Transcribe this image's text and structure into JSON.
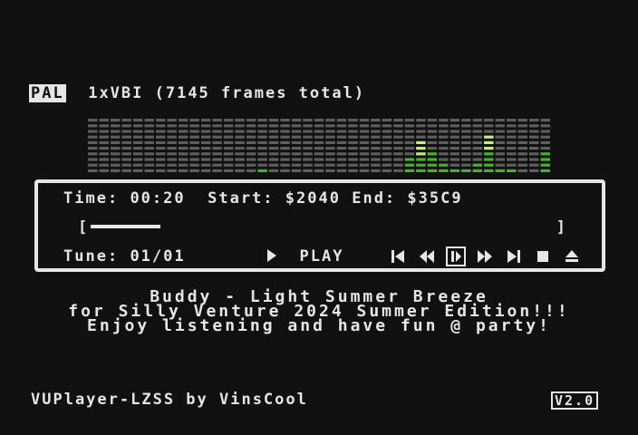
{
  "header": {
    "video_mode": "PAL",
    "info": "1xVBI (7145 frames total)"
  },
  "vu_meter": {
    "levels": [
      0,
      0,
      0,
      0,
      0,
      0,
      0,
      0,
      0,
      0,
      0,
      0,
      0,
      0,
      0,
      1,
      0,
      0,
      0,
      0,
      0,
      0,
      0,
      0,
      0,
      0,
      0,
      0,
      3,
      6,
      4,
      2,
      1,
      1,
      2,
      7,
      1,
      1,
      0,
      0,
      4
    ],
    "max_level": 10,
    "colors": {
      "off": "#5e5e5e",
      "low": "#48b030",
      "high": "#c8e890"
    }
  },
  "panel": {
    "time_label": "Time:",
    "time_value": "00:20",
    "start_label": "Start:",
    "start_value": "$2040",
    "end_label": "End:",
    "end_value": "$35C9",
    "progress_open": "[",
    "progress_close": "]",
    "progress": 0.15,
    "tune_label": "Tune:",
    "tune_value": "01/01",
    "play_label": "PLAY",
    "controls": [
      "skip-to-start-icon",
      "rewind-icon",
      "pause-icon",
      "fast-forward-icon",
      "skip-to-end-icon",
      "stop-icon",
      "eject-icon"
    ]
  },
  "message": {
    "line1": "Buddy - Light Summer Breeze",
    "line2": "for Silly Venture 2024 Summer Edition!!!",
    "line3": "Enjoy listening and have fun @  party!"
  },
  "footer": {
    "left": "VUPlayer-LZSS by VinsCool",
    "version": "V2.0"
  }
}
